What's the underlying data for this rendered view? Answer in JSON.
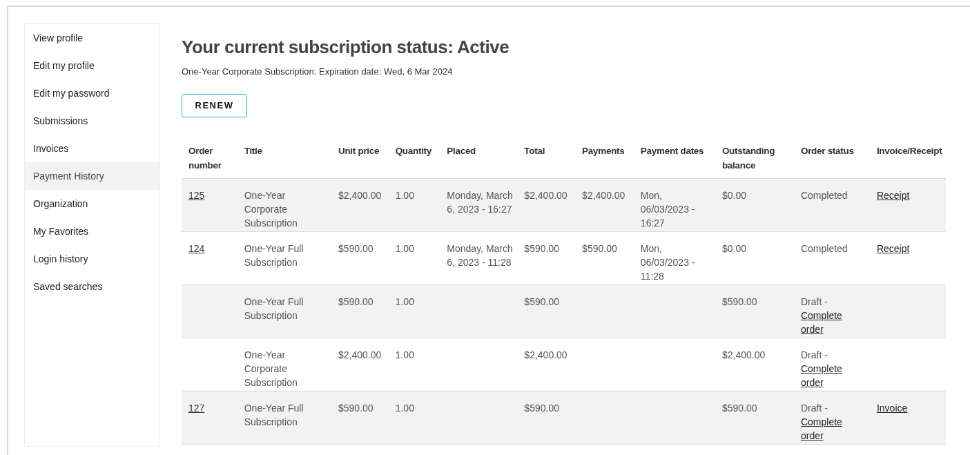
{
  "sidebar": {
    "items": [
      {
        "label": "View profile",
        "selected": false
      },
      {
        "label": "Edit my profile",
        "selected": false
      },
      {
        "label": "Edit my password",
        "selected": false
      },
      {
        "label": "Submissions",
        "selected": false
      },
      {
        "label": "Invoices",
        "selected": false
      },
      {
        "label": "Payment History",
        "selected": true
      },
      {
        "label": "Organization",
        "selected": false
      },
      {
        "label": "My Favorites",
        "selected": false
      },
      {
        "label": "Login history",
        "selected": false
      },
      {
        "label": "Saved searches",
        "selected": false
      }
    ]
  },
  "heading": "Your current subscription status: Active",
  "subtitle": "One-Year Corporate Subscription: Expiration date: Wed, 6 Mar 2024",
  "renew_button": "RENEW",
  "table": {
    "columns": [
      "Order number",
      "Title",
      "Unit price",
      "Quantity",
      "Placed",
      "Total",
      "Payments",
      "Payment dates",
      "Outstanding balance",
      "Order status",
      "Invoice/Receipt"
    ],
    "rows": [
      {
        "order_number": "125",
        "title": "One-Year Corporate Subscription",
        "unit_price": "$2,400.00",
        "quantity": "1.00",
        "placed": "Monday, March 6, 2023 - 16:27",
        "total": "$2,400.00",
        "payments": "$2,400.00",
        "payment_dates": "Mon, 06/03/2023 - 16:27",
        "outstanding_balance": "$0.00",
        "order_status": {
          "text": "Completed"
        },
        "invoice_receipt": "Receipt"
      },
      {
        "order_number": "124",
        "title": "One-Year Full Subscription",
        "unit_price": "$590.00",
        "quantity": "1.00",
        "placed": "Monday, March 6, 2023 - 11:28",
        "total": "$590.00",
        "payments": "$590.00",
        "payment_dates": "Mon, 06/03/2023 - 11:28",
        "outstanding_balance": "$0.00",
        "order_status": {
          "text": "Completed"
        },
        "invoice_receipt": "Receipt"
      },
      {
        "title": "One-Year Full Subscription",
        "unit_price": "$590.00",
        "quantity": "1.00",
        "total": "$590.00",
        "outstanding_balance": "$590.00",
        "order_status": {
          "text": "Draft -",
          "link": "Complete order"
        }
      },
      {
        "title": "One-Year Corporate Subscription",
        "unit_price": "$2,400.00",
        "quantity": "1.00",
        "total": "$2,400.00",
        "outstanding_balance": "$2,400.00",
        "order_status": {
          "text": "Draft -",
          "link": "Complete order"
        }
      },
      {
        "order_number": "127",
        "title": "One-Year Full Subscription",
        "unit_price": "$590.00",
        "quantity": "1.00",
        "total": "$590.00",
        "outstanding_balance": "$590.00",
        "order_status": {
          "text": "Draft -",
          "link": "Complete order"
        },
        "invoice_receipt": "Invoice"
      }
    ]
  }
}
